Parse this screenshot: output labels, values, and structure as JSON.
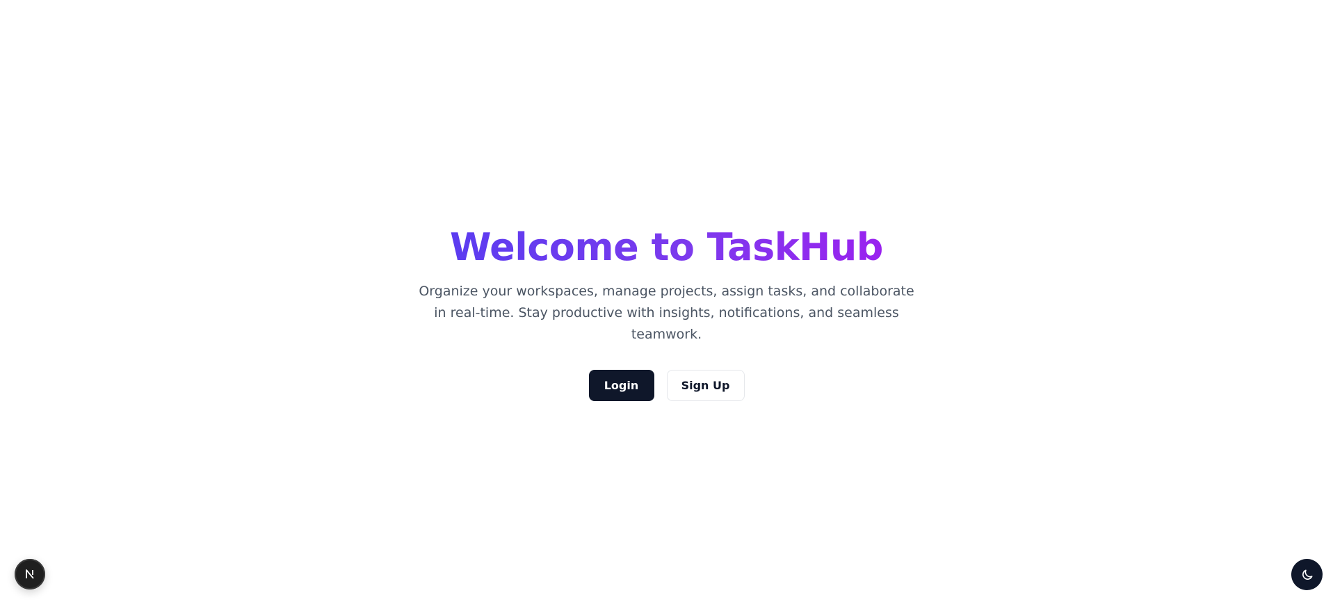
{
  "hero": {
    "title": "Welcome to TaskHub",
    "subtitle": "Organize your workspaces, manage projects, assign tasks, and collaborate in real-time. Stay productive with insights, notifications, and seamless teamwork."
  },
  "actions": {
    "login_label": "Login",
    "signup_label": "Sign Up"
  },
  "icons": {
    "dev_badge": "nextjs-icon",
    "theme_toggle": "moon-icon"
  },
  "colors": {
    "title_gradient_start": "#5b3cf0",
    "title_gradient_end": "#9a22ef",
    "primary_button": "#0f172a",
    "subtitle_text": "#4b5563"
  }
}
